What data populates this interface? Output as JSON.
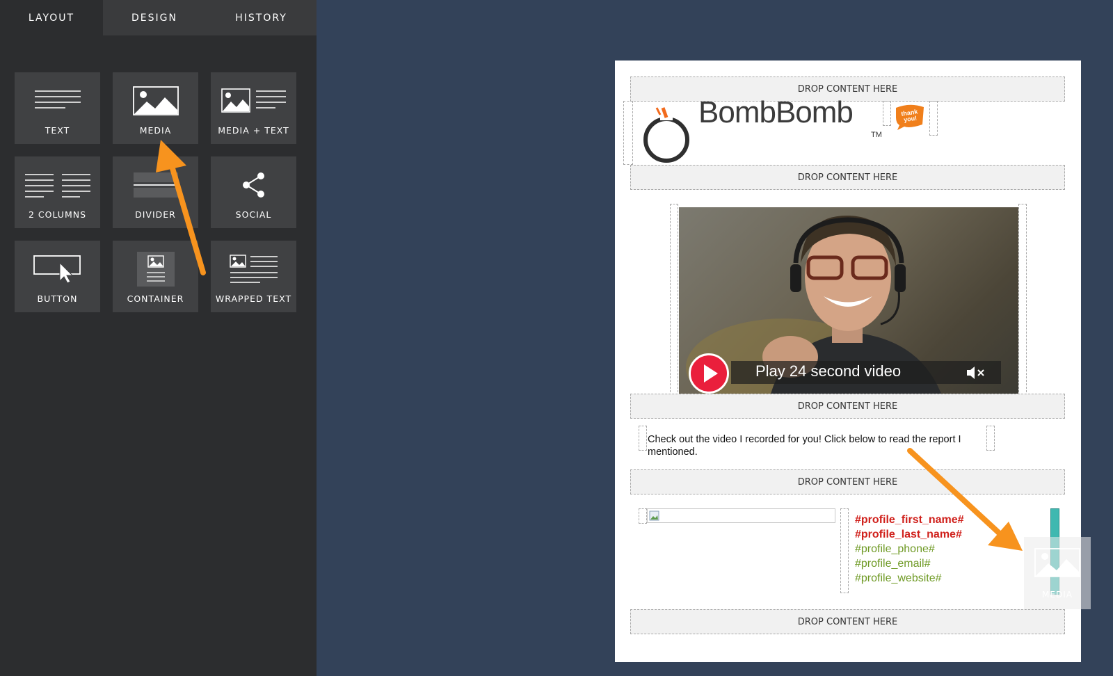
{
  "sidebar": {
    "tabs": [
      {
        "label": "LAYOUT",
        "active": true
      },
      {
        "label": "DESIGN",
        "active": false
      },
      {
        "label": "HISTORY",
        "active": false
      }
    ],
    "tiles": [
      {
        "label": "TEXT",
        "icon": "text-lines-icon"
      },
      {
        "label": "MEDIA",
        "icon": "image-icon"
      },
      {
        "label": "MEDIA + TEXT",
        "icon": "image-text-icon"
      },
      {
        "label": "2 COLUMNS",
        "icon": "two-columns-icon"
      },
      {
        "label": "DIVIDER",
        "icon": "divider-icon"
      },
      {
        "label": "SOCIAL",
        "icon": "share-icon"
      },
      {
        "label": "BUTTON",
        "icon": "button-cursor-icon"
      },
      {
        "label": "CONTAINER",
        "icon": "container-icon"
      },
      {
        "label": "WRAPPED TEXT",
        "icon": "wrapped-text-icon"
      }
    ]
  },
  "email": {
    "drop_label": "DROP CONTENT HERE",
    "brand": "BombBomb",
    "trademark": "TM",
    "badge_text": "thank you!",
    "video": {
      "play_label": "Play 24 second video"
    },
    "body_text": "Check out the video I recorded for you! Click below to read the report I mentioned.",
    "signature": {
      "first_name": "#profile_first_name#",
      "last_name": "#profile_last_name#",
      "phone": "#profile_phone#",
      "email": "#profile_email#",
      "website": "#profile_website#"
    },
    "drag_ghost_label": "MEDIA"
  },
  "colors": {
    "background": "#334259",
    "sidebar": "#2c2d2f",
    "tile": "#404143",
    "accent_arrow": "#f7931e",
    "play_red": "#ea1f3c",
    "signature_red": "#d0211c",
    "signature_green": "#6f9a25",
    "drop_indicator": "#3fb8b0"
  }
}
